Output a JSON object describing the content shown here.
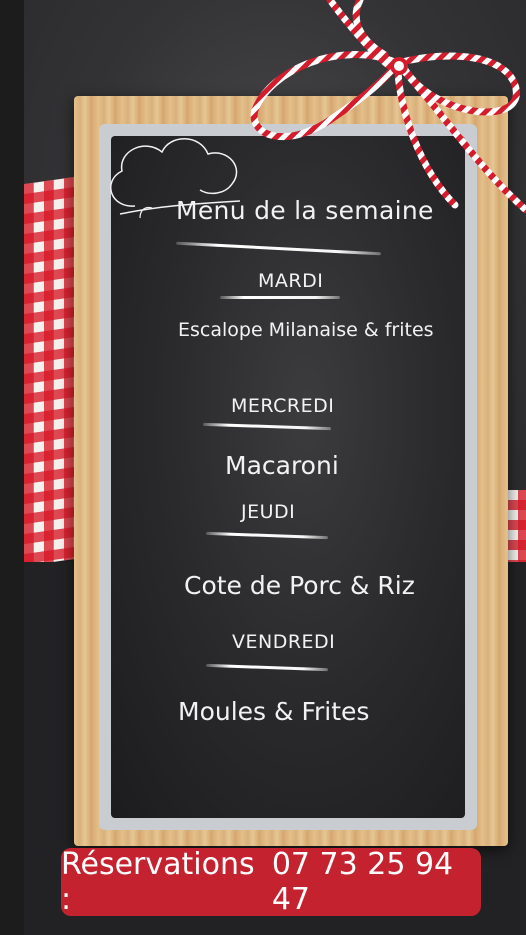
{
  "menu": {
    "title": "Menu de la semaine",
    "days": [
      {
        "day": "MARDI",
        "dish": "Escalope Milanaise & frites"
      },
      {
        "day": "MERCREDI",
        "dish": "Macaroni"
      },
      {
        "day": "JEUDI",
        "dish": "Cote de Porc & Riz"
      },
      {
        "day": "VENDREDI",
        "dish": "Moules & Frites"
      }
    ]
  },
  "reservation": {
    "label": "Réservations :",
    "phone": "07 73 25 94 47"
  },
  "colors": {
    "accent_red": "#c5222f",
    "chalk_white": "#f2f2f2",
    "slate": "#2a2a2c",
    "wood": "#ddb57f"
  },
  "decor": {
    "chef_hat": "chef-hat-icon",
    "ribbon": "ribbon-bow-icon",
    "tablecloth": "gingham-tablecloth"
  }
}
